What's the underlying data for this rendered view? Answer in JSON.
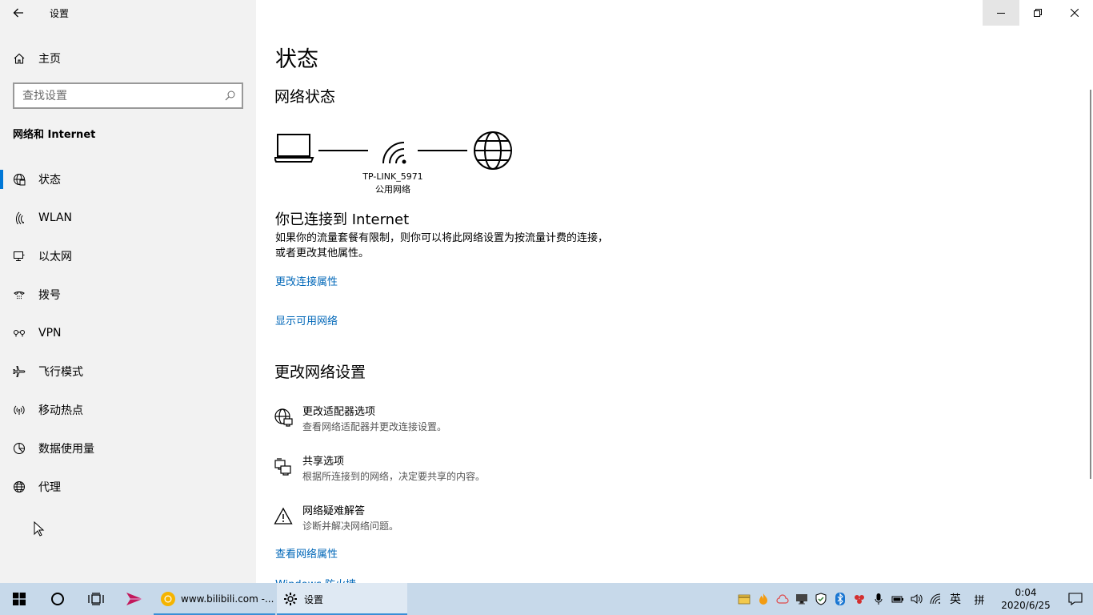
{
  "window": {
    "app_title": "设置",
    "controls": [
      "minimize",
      "restore",
      "close"
    ]
  },
  "sidebar": {
    "home_label": "主页",
    "search_placeholder": "查找设置",
    "section_title": "网络和 Internet",
    "items": [
      {
        "label": "状态",
        "icon": "globe-status-icon",
        "active": true
      },
      {
        "label": "WLAN",
        "icon": "wifi-icon",
        "active": false
      },
      {
        "label": "以太网",
        "icon": "ethernet-icon",
        "active": false
      },
      {
        "label": "拨号",
        "icon": "dialup-icon",
        "active": false
      },
      {
        "label": "VPN",
        "icon": "vpn-icon",
        "active": false
      },
      {
        "label": "飞行模式",
        "icon": "airplane-icon",
        "active": false
      },
      {
        "label": "移动热点",
        "icon": "hotspot-icon",
        "active": false
      },
      {
        "label": "数据使用量",
        "icon": "data-usage-icon",
        "active": false
      },
      {
        "label": "代理",
        "icon": "proxy-globe-icon",
        "active": false
      }
    ]
  },
  "main": {
    "page_title": "状态",
    "network_status_title": "网络状态",
    "network_name": "TP-LINK_5971",
    "network_type": "公用网络",
    "connected_title": "你已连接到 Internet",
    "connected_desc": "如果你的流量套餐有限制，则你可以将此网络设置为按流量计费的连接，或者更改其他属性。",
    "link_change_props": "更改连接属性",
    "link_show_networks": "显示可用网络",
    "change_settings_title": "更改网络设置",
    "settings": [
      {
        "title": "更改适配器选项",
        "desc": "查看网络适配器并更改连接设置。",
        "icon": "adapter-icon"
      },
      {
        "title": "共享选项",
        "desc": "根据所连接到的网络，决定要共享的内容。",
        "icon": "sharing-icon"
      },
      {
        "title": "网络疑难解答",
        "desc": "诊断并解决网络问题。",
        "icon": "warning-icon"
      }
    ],
    "link_view_props": "查看网络属性",
    "link_firewall": "Windows 防火墙"
  },
  "taskbar": {
    "apps": [
      {
        "label": "www.bilibili.com -...",
        "icon": "chrome-icon"
      },
      {
        "label": "设置",
        "icon": "settings-gear-icon"
      }
    ],
    "ime_label": "英",
    "ime_mode": "拼",
    "time": "0:04",
    "date": "2020/6/25"
  },
  "colors": {
    "accent": "#0078d7",
    "link": "#0067b8",
    "sidebar_bg": "#f2f2f2",
    "taskbar_bg": "#c7d9ea"
  }
}
